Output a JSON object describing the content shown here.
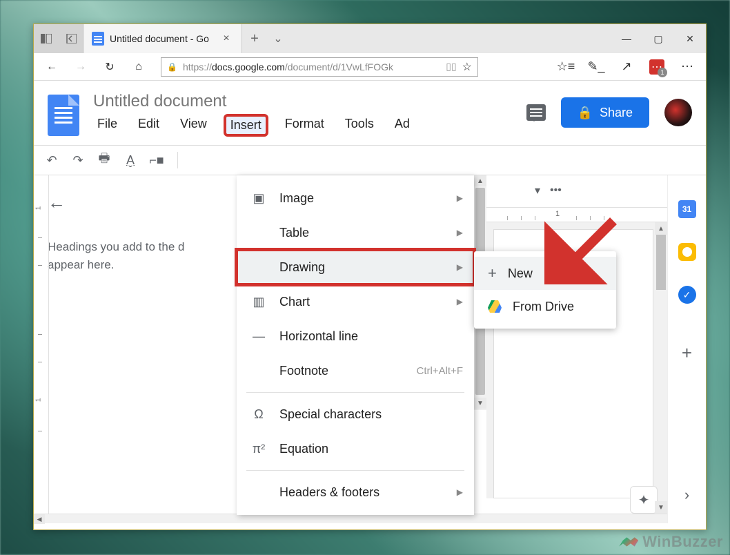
{
  "browser": {
    "tab_title": "Untitled document - Go",
    "url_prefix": "https://",
    "url_host": "docs.google.com",
    "url_path": "/document/d/1VwLfFOGk",
    "ext_badge_count": "1"
  },
  "doc": {
    "title": "Untitled document",
    "menu": {
      "file": "File",
      "edit": "Edit",
      "view": "View",
      "insert": "Insert",
      "format": "Format",
      "tools": "Tools",
      "addons": "Ad"
    },
    "share": "Share",
    "outline_hint": "Headings you add to the d appear here."
  },
  "insert_menu": {
    "image": "Image",
    "table": "Table",
    "drawing": "Drawing",
    "chart": "Chart",
    "hline": "Horizontal line",
    "footnote": "Footnote",
    "footnote_shortcut": "Ctrl+Alt+F",
    "special": "Special characters",
    "equation": "Equation",
    "headers_footers": "Headers & footers"
  },
  "drawing_submenu": {
    "new": "New",
    "from_drive": "From Drive"
  },
  "ruler": {
    "one": "1",
    "neg_one": "1"
  },
  "sidepanel": {
    "calendar_day": "31"
  },
  "watermark": "WinBuzzer"
}
